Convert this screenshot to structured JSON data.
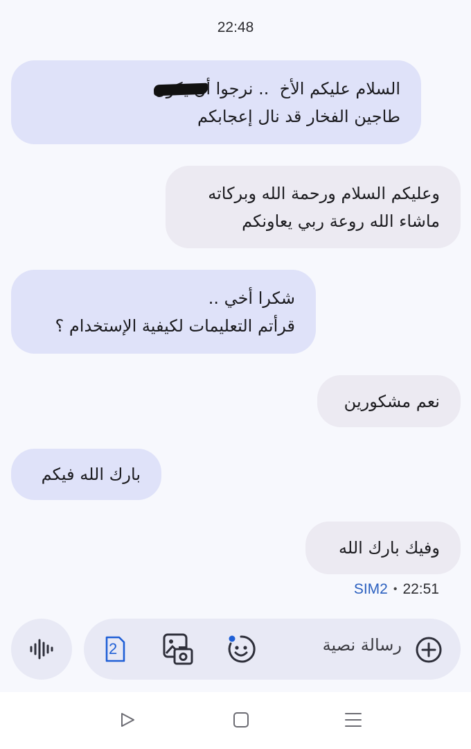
{
  "header": {
    "time": "22:48"
  },
  "messages": [
    {
      "direction": "incoming",
      "lines": [
        "السلام عليكم الأخ ‏ .. نرجوا أن يكون",
        "طاجين الفخار قد نال إعجابكم"
      ]
    },
    {
      "direction": "outgoing",
      "lines": [
        "وعليكم السلام ورحمة الله وبركاته",
        "ماشاء الله روعة ربي يعاونكم"
      ]
    },
    {
      "direction": "incoming",
      "lines": [
        "شكرا أخي ..",
        "قرأتم التعليمات لكيفية الإستخدام ؟"
      ]
    },
    {
      "direction": "outgoing",
      "lines": [
        "نعم مشكورين"
      ]
    },
    {
      "direction": "incoming",
      "lines": [
        "بارك الله فيكم"
      ]
    },
    {
      "direction": "outgoing",
      "lines": [
        "وفيك بارك الله"
      ]
    }
  ],
  "last_meta": {
    "sim": "SIM2",
    "separator": "•",
    "time": "22:51"
  },
  "composer": {
    "placeholder": "رسالة نصية",
    "sim_badge": "2",
    "icons": [
      "add-icon",
      "emoji-icon",
      "gallery-icon",
      "sim-icon",
      "voice-icon"
    ]
  },
  "navbar": {
    "icons": [
      "back-icon",
      "home-icon",
      "recents-icon"
    ]
  },
  "colors": {
    "background": "#f7f8fd",
    "incoming_bubble": "#dfe2f9",
    "outgoing_bubble": "#eceaf2",
    "sim_label": "#2a5fbf",
    "sim_icon": "#1f5fd6"
  }
}
